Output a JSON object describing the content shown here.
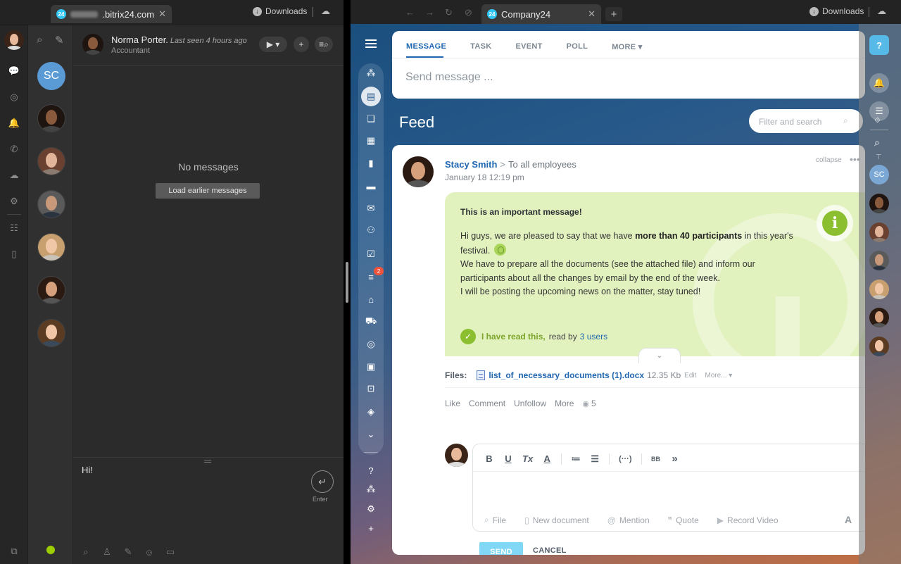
{
  "left_window": {
    "tab": {
      "favicon": "24",
      "title": ".bitrix24.com",
      "close": "✕"
    },
    "toolbar": {
      "downloads_label": "Downloads"
    },
    "chat": {
      "contact_name": "Norma Porter.",
      "last_seen": "Last seen 4 hours ago",
      "contact_role": "Accountant",
      "empty_text": "No messages",
      "load_earlier_label": "Load earlier messages",
      "draft_text": "Hi!",
      "enter_label": "Enter"
    },
    "contact_list": {
      "first_initials": "SC"
    }
  },
  "right_window": {
    "tab": {
      "favicon": "24",
      "title": "Company24",
      "close": "✕"
    },
    "toolbar": {
      "downloads_label": "Downloads",
      "new_tab": "+"
    },
    "post_form": {
      "tabs": [
        "MESSAGE",
        "TASK",
        "EVENT",
        "POLL",
        "MORE ▾"
      ],
      "placeholder": "Send message ..."
    },
    "feed": {
      "title": "Feed",
      "filter_placeholder": "Filter and search"
    },
    "menu_badge": "2",
    "post": {
      "author": "Stacy Smith",
      "arrow": ">",
      "target": "To all employees",
      "date": "January 18 12:19 pm",
      "collapse_label": "collapse",
      "more_label": "•••",
      "important_title": "This is an important message!",
      "body_1a": "Hi guys, we are pleased to say that we have ",
      "body_1b": "more than 40 participants",
      "body_1c": " in this year's festival.",
      "body_2": "We have to prepare all the documents (see the attached file) and inform our participants about all the changes by email by the end of the week.",
      "body_3": "I will be posting the upcoming news on the matter, stay tuned!",
      "read_label": "I have read this,",
      "read_by": "read by",
      "read_users": "3 users",
      "files_label": "Files:",
      "file_name": "list_of_necessary_documents (1).docx",
      "file_size": "12.35 Kb",
      "file_edit": "Edit",
      "file_more": "More... ▾",
      "actions": [
        "Like",
        "Comment",
        "Unfollow",
        "More"
      ],
      "views": "5"
    },
    "editor": {
      "toolbar": [
        "B",
        "U",
        "Tx",
        "A",
        "≔",
        "☰",
        "(···)",
        "BB",
        "»"
      ],
      "bottom": [
        "File",
        "New document",
        "Mention",
        "Quote",
        "Record Video"
      ],
      "font_button": "A",
      "send_label": "SEND",
      "cancel_label": "CANCEL"
    },
    "right_rail": {
      "help": "?",
      "user_initials": "SC"
    }
  },
  "colors": {
    "accent_blue": "#2067b0",
    "important_bg": "#e2f2bf",
    "important_green": "#8cbf2f",
    "send_button": "#81d8f6",
    "online": "#9dcf00"
  }
}
